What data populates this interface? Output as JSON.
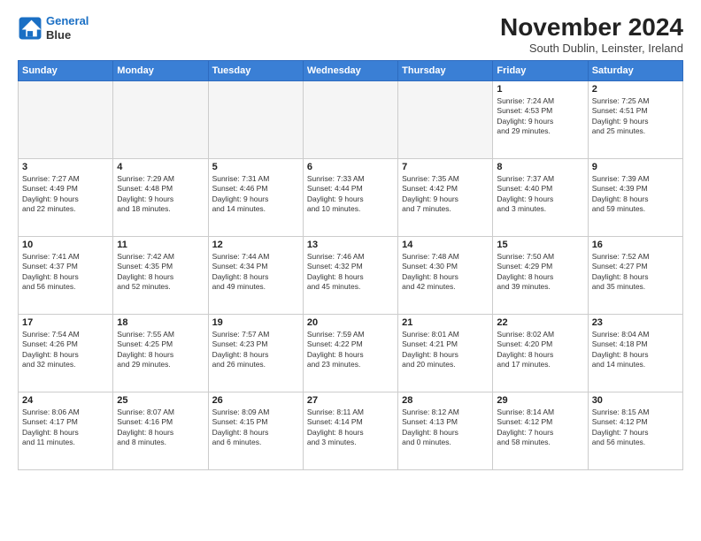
{
  "logo": {
    "line1": "General",
    "line2": "Blue"
  },
  "title": "November 2024",
  "subtitle": "South Dublin, Leinster, Ireland",
  "weekdays": [
    "Sunday",
    "Monday",
    "Tuesday",
    "Wednesday",
    "Thursday",
    "Friday",
    "Saturday"
  ],
  "weeks": [
    [
      {
        "day": "",
        "info": ""
      },
      {
        "day": "",
        "info": ""
      },
      {
        "day": "",
        "info": ""
      },
      {
        "day": "",
        "info": ""
      },
      {
        "day": "",
        "info": ""
      },
      {
        "day": "1",
        "info": "Sunrise: 7:24 AM\nSunset: 4:53 PM\nDaylight: 9 hours\nand 29 minutes."
      },
      {
        "day": "2",
        "info": "Sunrise: 7:25 AM\nSunset: 4:51 PM\nDaylight: 9 hours\nand 25 minutes."
      }
    ],
    [
      {
        "day": "3",
        "info": "Sunrise: 7:27 AM\nSunset: 4:49 PM\nDaylight: 9 hours\nand 22 minutes."
      },
      {
        "day": "4",
        "info": "Sunrise: 7:29 AM\nSunset: 4:48 PM\nDaylight: 9 hours\nand 18 minutes."
      },
      {
        "day": "5",
        "info": "Sunrise: 7:31 AM\nSunset: 4:46 PM\nDaylight: 9 hours\nand 14 minutes."
      },
      {
        "day": "6",
        "info": "Sunrise: 7:33 AM\nSunset: 4:44 PM\nDaylight: 9 hours\nand 10 minutes."
      },
      {
        "day": "7",
        "info": "Sunrise: 7:35 AM\nSunset: 4:42 PM\nDaylight: 9 hours\nand 7 minutes."
      },
      {
        "day": "8",
        "info": "Sunrise: 7:37 AM\nSunset: 4:40 PM\nDaylight: 9 hours\nand 3 minutes."
      },
      {
        "day": "9",
        "info": "Sunrise: 7:39 AM\nSunset: 4:39 PM\nDaylight: 8 hours\nand 59 minutes."
      }
    ],
    [
      {
        "day": "10",
        "info": "Sunrise: 7:41 AM\nSunset: 4:37 PM\nDaylight: 8 hours\nand 56 minutes."
      },
      {
        "day": "11",
        "info": "Sunrise: 7:42 AM\nSunset: 4:35 PM\nDaylight: 8 hours\nand 52 minutes."
      },
      {
        "day": "12",
        "info": "Sunrise: 7:44 AM\nSunset: 4:34 PM\nDaylight: 8 hours\nand 49 minutes."
      },
      {
        "day": "13",
        "info": "Sunrise: 7:46 AM\nSunset: 4:32 PM\nDaylight: 8 hours\nand 45 minutes."
      },
      {
        "day": "14",
        "info": "Sunrise: 7:48 AM\nSunset: 4:30 PM\nDaylight: 8 hours\nand 42 minutes."
      },
      {
        "day": "15",
        "info": "Sunrise: 7:50 AM\nSunset: 4:29 PM\nDaylight: 8 hours\nand 39 minutes."
      },
      {
        "day": "16",
        "info": "Sunrise: 7:52 AM\nSunset: 4:27 PM\nDaylight: 8 hours\nand 35 minutes."
      }
    ],
    [
      {
        "day": "17",
        "info": "Sunrise: 7:54 AM\nSunset: 4:26 PM\nDaylight: 8 hours\nand 32 minutes."
      },
      {
        "day": "18",
        "info": "Sunrise: 7:55 AM\nSunset: 4:25 PM\nDaylight: 8 hours\nand 29 minutes."
      },
      {
        "day": "19",
        "info": "Sunrise: 7:57 AM\nSunset: 4:23 PM\nDaylight: 8 hours\nand 26 minutes."
      },
      {
        "day": "20",
        "info": "Sunrise: 7:59 AM\nSunset: 4:22 PM\nDaylight: 8 hours\nand 23 minutes."
      },
      {
        "day": "21",
        "info": "Sunrise: 8:01 AM\nSunset: 4:21 PM\nDaylight: 8 hours\nand 20 minutes."
      },
      {
        "day": "22",
        "info": "Sunrise: 8:02 AM\nSunset: 4:20 PM\nDaylight: 8 hours\nand 17 minutes."
      },
      {
        "day": "23",
        "info": "Sunrise: 8:04 AM\nSunset: 4:18 PM\nDaylight: 8 hours\nand 14 minutes."
      }
    ],
    [
      {
        "day": "24",
        "info": "Sunrise: 8:06 AM\nSunset: 4:17 PM\nDaylight: 8 hours\nand 11 minutes."
      },
      {
        "day": "25",
        "info": "Sunrise: 8:07 AM\nSunset: 4:16 PM\nDaylight: 8 hours\nand 8 minutes."
      },
      {
        "day": "26",
        "info": "Sunrise: 8:09 AM\nSunset: 4:15 PM\nDaylight: 8 hours\nand 6 minutes."
      },
      {
        "day": "27",
        "info": "Sunrise: 8:11 AM\nSunset: 4:14 PM\nDaylight: 8 hours\nand 3 minutes."
      },
      {
        "day": "28",
        "info": "Sunrise: 8:12 AM\nSunset: 4:13 PM\nDaylight: 8 hours\nand 0 minutes."
      },
      {
        "day": "29",
        "info": "Sunrise: 8:14 AM\nSunset: 4:12 PM\nDaylight: 7 hours\nand 58 minutes."
      },
      {
        "day": "30",
        "info": "Sunrise: 8:15 AM\nSunset: 4:12 PM\nDaylight: 7 hours\nand 56 minutes."
      }
    ]
  ]
}
